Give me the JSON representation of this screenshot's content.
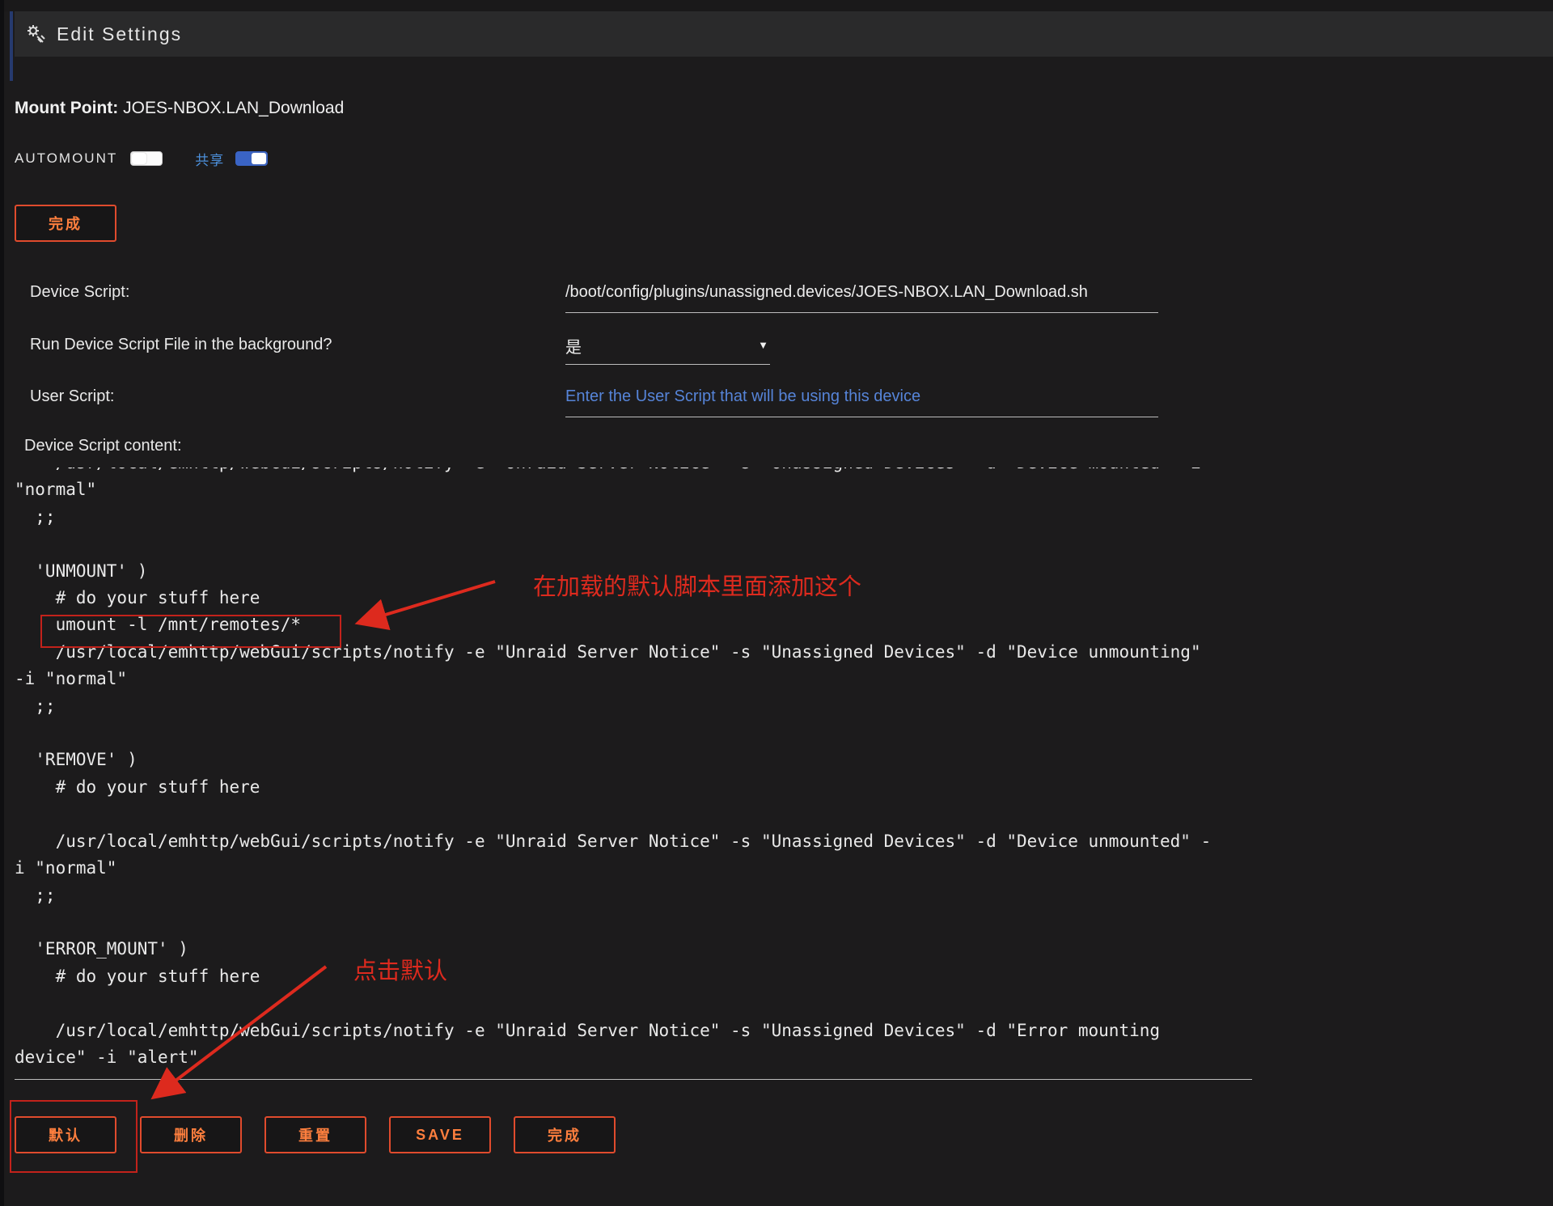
{
  "header": {
    "title": "Edit Settings",
    "icon": "gear-icon"
  },
  "mount": {
    "label": "Mount Point:",
    "value": "JOES-NBOX.LAN_Download"
  },
  "toggles": {
    "automount_label": "AUTOMOUNT",
    "automount_on": false,
    "share_label": "共享",
    "share_on": true
  },
  "top_button": {
    "done_label": "完成"
  },
  "form": {
    "device_script_label": "Device Script:",
    "device_script_value": "/boot/config/plugins/unassigned.devices/JOES-NBOX.LAN_Download.sh",
    "background_label": "Run Device Script File in the background?",
    "background_value": "是",
    "user_script_label": "User Script:",
    "user_script_placeholder": "Enter the User Script that will be using this device",
    "content_label": "Device Script content:"
  },
  "script": {
    "lines": [
      "    /usr/local/emhttp/webGui/scripts/notify -e \"Unraid Server Notice\" -s \"Unassigned Devices\" -d \"Device mounted\" -i",
      "\"normal\"",
      "  ;;",
      "",
      "  'UNMOUNT' )",
      "    # do your stuff here",
      "    umount -l /mnt/remotes/*",
      "    /usr/local/emhttp/webGui/scripts/notify -e \"Unraid Server Notice\" -s \"Unassigned Devices\" -d \"Device unmounting\"",
      "-i \"normal\"",
      "  ;;",
      "",
      "  'REMOVE' )",
      "    # do your stuff here",
      "",
      "    /usr/local/emhttp/webGui/scripts/notify -e \"Unraid Server Notice\" -s \"Unassigned Devices\" -d \"Device unmounted\" -",
      "i \"normal\"",
      "  ;;",
      "",
      "  'ERROR_MOUNT' )",
      "    # do your stuff here",
      "",
      "    /usr/local/emhttp/webGui/scripts/notify -e \"Unraid Server Notice\" -s \"Unassigned Devices\" -d \"Error mounting",
      "device\" -i \"alert\""
    ]
  },
  "annotations": {
    "add_this": "在加载的默认脚本里面添加这个",
    "click_default": "点击默认",
    "color": "#dd2a1e"
  },
  "buttons": {
    "default": "默认",
    "delete": "删除",
    "reset": "重置",
    "save": "SAVE",
    "done": "完成"
  },
  "colors": {
    "button_border": "#e04b2d",
    "button_text": "#ff7f3e",
    "toggle_on": "#3a64c5",
    "placeholder": "#5684d8"
  }
}
